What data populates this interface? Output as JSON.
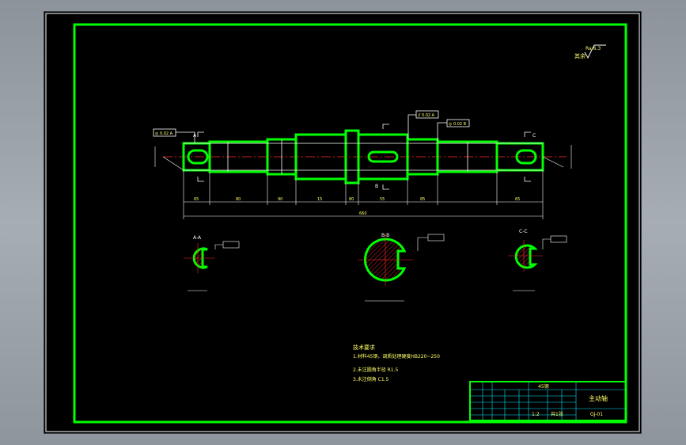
{
  "roughness_symbol": "Ra 6.3",
  "rough_label": "其余",
  "section_labels": {
    "aa": "A-A",
    "bb": "B-B",
    "cc": "C-C"
  },
  "callouts": {
    "tol_left": "◎ 0.02 A",
    "tol_mid": "// 0.02 A",
    "tol_right": "◎ 0.02 B",
    "cut_a": "A",
    "cut_b": "B",
    "cut_c": "C"
  },
  "dimensions": {
    "overall": "660",
    "seg1": "65",
    "seg2": "80",
    "seg3": "90",
    "seg4": "15",
    "seg5": "80",
    "seg6": "55",
    "seg7": "85",
    "seg8": "65"
  },
  "tech_notes": {
    "title": "技术要求",
    "lines": [
      "1.材料45钢，调质处理硬度HB220~250",
      "2.未注圆角半径 R1.5",
      "3.未注倒角 C1.5"
    ]
  },
  "title_block": {
    "part_name": "主动轴",
    "material": "45钢",
    "drawing_no": "GJ-01",
    "scale": "1:2",
    "sheet": "共1张"
  }
}
